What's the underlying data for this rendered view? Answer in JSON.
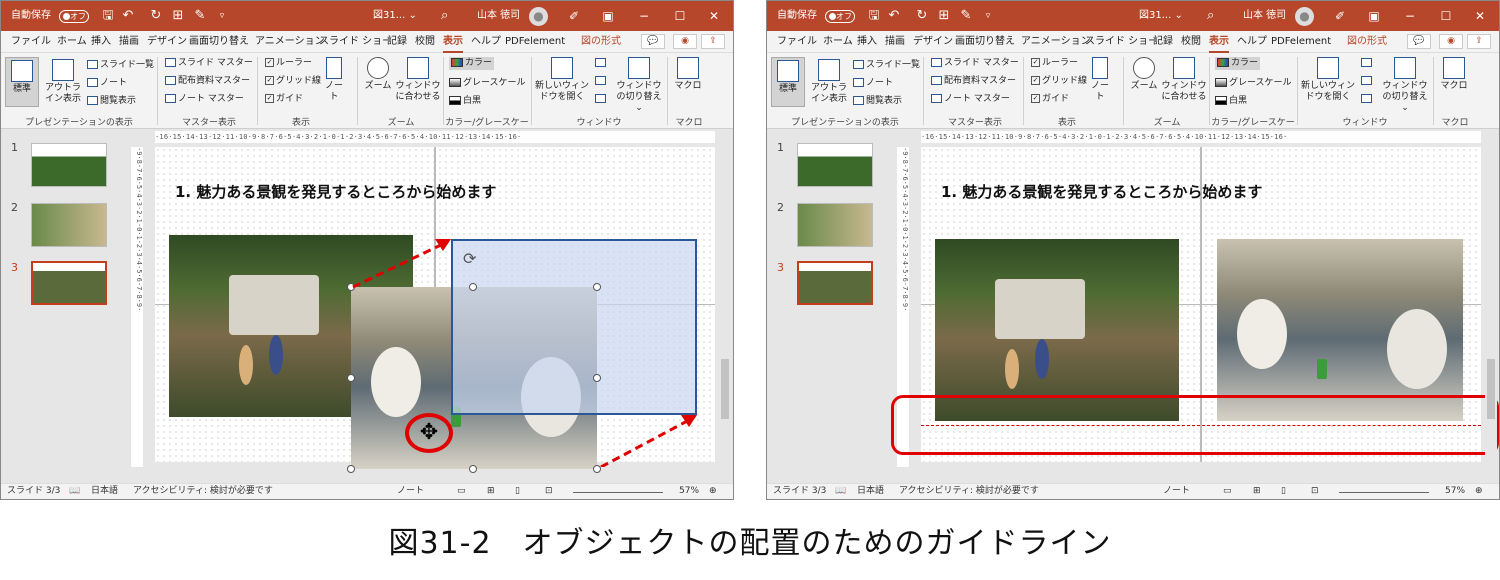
{
  "titlebar": {
    "autosave_label": "自動保存",
    "autosave_state": "オフ",
    "doc_title": "図31... ⌄",
    "user_name": "山本 徳司",
    "minimize": "−",
    "restore": "☐",
    "close": "✕"
  },
  "menu": {
    "items": [
      "ファイル",
      "ホーム",
      "挿入",
      "描画",
      "デザイン",
      "画面切り替え",
      "アニメーション",
      "スライド ショー",
      "記録",
      "校閲",
      "表示",
      "ヘルプ",
      "PDFelement",
      "図の形式"
    ],
    "active": "表示",
    "contextual": "図の形式"
  },
  "ribbon": {
    "presentation_views": {
      "normal": "標準",
      "outline": "アウトライン表示",
      "slide_sorter": "スライド一覧",
      "notes": "ノート",
      "reading": "閲覧表示",
      "group": "プレゼンテーションの表示"
    },
    "master_views": {
      "slide_master": "スライド マスター",
      "handout_master": "配布資料マスター",
      "notes_master": "ノート マスター",
      "group": "マスター表示"
    },
    "show": {
      "ruler": "ルーラー",
      "gridlines": "グリッド線",
      "guides": "ガイド",
      "notes": "ノート",
      "group": "表示"
    },
    "zoom": {
      "zoom": "ズーム",
      "fit": "ウィンドウに合わせる",
      "group": "ズーム"
    },
    "color": {
      "color": "カラー",
      "grayscale": "グレースケール",
      "bw": "白黒",
      "group": "カラー/グレースケール"
    },
    "window": {
      "new_window": "新しいウィンドウを開く",
      "switch": "ウィンドウの切り替え ⌄",
      "group": "ウィンドウ"
    },
    "macro": {
      "macro": "マクロ",
      "group": "マクロ"
    }
  },
  "thumbnails": [
    "1",
    "2",
    "3"
  ],
  "slide": {
    "heading": "1. 魅力ある景観を発見するところから始めます",
    "hruler": "·16·15·14·13·12·11·10·9·8·7·6·5·4·3·2·1·0·1·2·3·4·5·6·7·6·5·4·10·11·12·13·14·15·16·",
    "vruler": "·9·8·7·6·5·4·3·2·1·0·1·2·3·4·5·6·7·8·9·"
  },
  "status": {
    "slide": "スライド 3/3",
    "language": "日本語",
    "accessibility": "アクセシビリティ: 検討が必要です",
    "notes": "ノート",
    "zoom": "57%"
  },
  "caption": "図31-2　オブジェクトの配置のためのガイドライン",
  "colors": {
    "brand": "#b7472a",
    "annotation": "#e00000",
    "selection": "#2b5797"
  }
}
